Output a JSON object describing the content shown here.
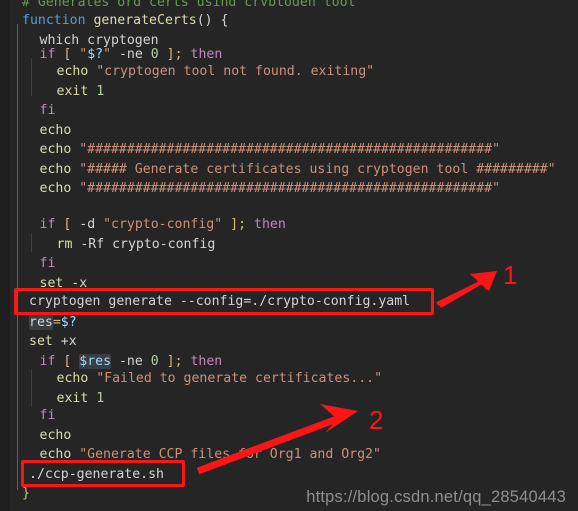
{
  "editor": {
    "background_color": "#252526",
    "gutter_color": "#1e1e1e",
    "language": "shell",
    "font_size_px": 13.2,
    "line_height_px": 19.5
  },
  "code": {
    "lines": [
      {
        "n": 0,
        "indent": 1,
        "text": "# Generates org certs using cryptogen tool",
        "kind": "comment"
      },
      {
        "n": 1,
        "indent": 0,
        "text": "function generateCerts() {"
      },
      {
        "n": 2,
        "indent": 1,
        "text": "which cryptogen"
      },
      {
        "n": 3,
        "indent": 1,
        "text": "if [ \"$?\" -ne 0 ]; then"
      },
      {
        "n": 4,
        "indent": 2,
        "text": "echo \"cryptogen tool not found. exiting\""
      },
      {
        "n": 5,
        "indent": 2,
        "text": "exit 1"
      },
      {
        "n": 6,
        "indent": 1,
        "text": "fi"
      },
      {
        "n": 7,
        "indent": 1,
        "text": "echo"
      },
      {
        "n": 8,
        "indent": 1,
        "text": "echo \"###################################################\""
      },
      {
        "n": 9,
        "indent": 1,
        "text": "echo \"##### Generate certificates using cryptogen tool #########\""
      },
      {
        "n": 10,
        "indent": 1,
        "text": "echo \"###################################################\""
      },
      {
        "n": 11,
        "indent": 1,
        "text": ""
      },
      {
        "n": 12,
        "indent": 1,
        "text": "if [ -d \"crypto-config\" ]; then"
      },
      {
        "n": 13,
        "indent": 2,
        "text": "rm -Rf crypto-config"
      },
      {
        "n": 14,
        "indent": 1,
        "text": "fi"
      },
      {
        "n": 15,
        "indent": 1,
        "text": "set -x"
      },
      {
        "n": 16,
        "indent": 1,
        "text": "cryptogen generate --config=./crypto-config.yaml"
      },
      {
        "n": 17,
        "indent": 1,
        "text": "res=$?"
      },
      {
        "n": 18,
        "indent": 1,
        "text": "set +x"
      },
      {
        "n": 19,
        "indent": 1,
        "text": "if [ $res -ne 0 ]; then"
      },
      {
        "n": 20,
        "indent": 2,
        "text": "echo \"Failed to generate certificates...\""
      },
      {
        "n": 21,
        "indent": 2,
        "text": "exit 1"
      },
      {
        "n": 22,
        "indent": 1,
        "text": "fi"
      },
      {
        "n": 23,
        "indent": 1,
        "text": "echo"
      },
      {
        "n": 24,
        "indent": 1,
        "text": "echo \"Generate CCP files for Org1 and Org2\""
      },
      {
        "n": 25,
        "indent": 1,
        "text": "./ccp-generate.sh"
      },
      {
        "n": 26,
        "indent": 0,
        "text": "}"
      }
    ],
    "tokens": {
      "l0": [
        {
          "t": "# Generates org certs using cryptogen tool",
          "c": "comment"
        }
      ],
      "l1": [
        {
          "t": "function",
          "c": "fnkw"
        },
        {
          "t": " ",
          "c": "plain"
        },
        {
          "t": "generateCerts",
          "c": "fnname"
        },
        {
          "t": "() {",
          "c": "plain"
        }
      ],
      "l2": [
        {
          "t": "which cryptogen",
          "c": "plain"
        }
      ],
      "l3": [
        {
          "t": "if",
          "c": "kw"
        },
        {
          "t": " ",
          "c": "plain"
        },
        {
          "t": "[",
          "c": "punc"
        },
        {
          "t": " ",
          "c": "plain"
        },
        {
          "t": "\"",
          "c": "str"
        },
        {
          "t": "$?",
          "c": "var"
        },
        {
          "t": "\"",
          "c": "str"
        },
        {
          "t": " -ne ",
          "c": "plain"
        },
        {
          "t": "0",
          "c": "num"
        },
        {
          "t": " ",
          "c": "plain"
        },
        {
          "t": "]",
          "c": "punc"
        },
        {
          "t": ";",
          "c": "punc"
        },
        {
          "t": " ",
          "c": "plain"
        },
        {
          "t": "then",
          "c": "kw"
        }
      ],
      "l4": [
        {
          "t": "echo",
          "c": "cmd"
        },
        {
          "t": " ",
          "c": "plain"
        },
        {
          "t": "\"cryptogen tool not found. exiting\"",
          "c": "str"
        }
      ],
      "l5": [
        {
          "t": "exit",
          "c": "cmd"
        },
        {
          "t": " ",
          "c": "plain"
        },
        {
          "t": "1",
          "c": "num"
        }
      ],
      "l6": [
        {
          "t": "fi",
          "c": "kw"
        }
      ],
      "l7": [
        {
          "t": "echo",
          "c": "cmd"
        }
      ],
      "l8": [
        {
          "t": "echo",
          "c": "cmd"
        },
        {
          "t": " ",
          "c": "plain"
        },
        {
          "t": "\"###################################################\"",
          "c": "str"
        }
      ],
      "l9": [
        {
          "t": "echo",
          "c": "cmd"
        },
        {
          "t": " ",
          "c": "plain"
        },
        {
          "t": "\"##### Generate certificates using cryptogen tool #########\"",
          "c": "str"
        }
      ],
      "l10": [
        {
          "t": "echo",
          "c": "cmd"
        },
        {
          "t": " ",
          "c": "plain"
        },
        {
          "t": "\"###################################################\"",
          "c": "str"
        }
      ],
      "l11": [],
      "l12": [
        {
          "t": "if",
          "c": "kw"
        },
        {
          "t": " ",
          "c": "plain"
        },
        {
          "t": "[",
          "c": "punc"
        },
        {
          "t": " ",
          "c": "plain"
        },
        {
          "t": "-d",
          "c": "opt"
        },
        {
          "t": " ",
          "c": "plain"
        },
        {
          "t": "\"crypto-config\"",
          "c": "str"
        },
        {
          "t": " ",
          "c": "plain"
        },
        {
          "t": "]",
          "c": "punc"
        },
        {
          "t": ";",
          "c": "punc"
        },
        {
          "t": " ",
          "c": "plain"
        },
        {
          "t": "then",
          "c": "kw"
        }
      ],
      "l13": [
        {
          "t": "rm",
          "c": "cmd"
        },
        {
          "t": " -Rf crypto-config",
          "c": "plain"
        }
      ],
      "l14": [
        {
          "t": "fi",
          "c": "kw"
        }
      ],
      "l15": [
        {
          "t": "set",
          "c": "cmd"
        },
        {
          "t": " -x",
          "c": "plain"
        }
      ],
      "l16": [
        {
          "t": "cryptogen generate --config=./crypto-config.yaml",
          "c": "plain"
        }
      ],
      "l17": [
        {
          "t": "res",
          "c": "plain-hl"
        },
        {
          "t": "=",
          "c": "punc"
        },
        {
          "t": "$?",
          "c": "var"
        }
      ],
      "l18": [
        {
          "t": "set",
          "c": "cmd"
        },
        {
          "t": " +x",
          "c": "plain"
        }
      ],
      "l19": [
        {
          "t": "if",
          "c": "kw"
        },
        {
          "t": " ",
          "c": "plain"
        },
        {
          "t": "[",
          "c": "punc"
        },
        {
          "t": " ",
          "c": "plain"
        },
        {
          "t": "$res",
          "c": "var-hl"
        },
        {
          "t": " -ne ",
          "c": "plain"
        },
        {
          "t": "0",
          "c": "num"
        },
        {
          "t": " ",
          "c": "plain"
        },
        {
          "t": "]",
          "c": "punc"
        },
        {
          "t": ";",
          "c": "punc"
        },
        {
          "t": " ",
          "c": "plain"
        },
        {
          "t": "then",
          "c": "kw"
        }
      ],
      "l20": [
        {
          "t": "echo",
          "c": "cmd"
        },
        {
          "t": " ",
          "c": "plain"
        },
        {
          "t": "\"Failed to generate certificates...\"",
          "c": "str"
        }
      ],
      "l21": [
        {
          "t": "exit",
          "c": "cmd"
        },
        {
          "t": " ",
          "c": "plain"
        },
        {
          "t": "1",
          "c": "num"
        }
      ],
      "l22": [
        {
          "t": "fi",
          "c": "kw"
        }
      ],
      "l23": [
        {
          "t": "echo",
          "c": "cmd"
        }
      ],
      "l24": [
        {
          "t": "echo",
          "c": "cmd"
        },
        {
          "t": " ",
          "c": "plain"
        },
        {
          "t": "\"Generate CCP files for Org1 and Org2\"",
          "c": "str"
        }
      ],
      "l25": [
        {
          "t": "./ccp-generate.sh",
          "c": "plain"
        }
      ],
      "l26": [
        {
          "t": "}",
          "c": "punc"
        }
      ]
    }
  },
  "annotations": {
    "color": "#fa1616",
    "callouts": [
      {
        "id": 1,
        "label": "1",
        "target_line_text": "cryptogen generate --config=./crypto-config.yaml"
      },
      {
        "id": 2,
        "label": "2",
        "target_line_text": "./ccp-generate.sh"
      }
    ]
  },
  "watermark": {
    "text": "https://blog.csdn.net/qq_28540443"
  }
}
